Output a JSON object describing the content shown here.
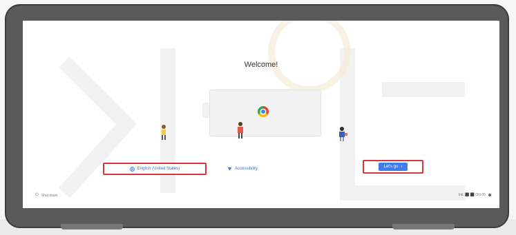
{
  "screen": {
    "title": "Welcome!",
    "language_button": {
      "label": "English (United States)",
      "icon": "globe-icon"
    },
    "accessibility_button": {
      "label": "Accessibility",
      "icon": "accessibility-icon"
    },
    "start_button": {
      "label": "Let's go",
      "icon": "chevron-right-icon"
    },
    "shelf_left": {
      "label": "Shut down",
      "icon": "power-icon"
    },
    "shelf_right": {
      "label": "Intl. ⬛ ⬛ Oct 05",
      "icon": "network-icon"
    }
  },
  "colors": {
    "accent": "#3f7ee8",
    "highlight_border": "#d9353b",
    "laptop_bezel": "#5a5a5a"
  }
}
